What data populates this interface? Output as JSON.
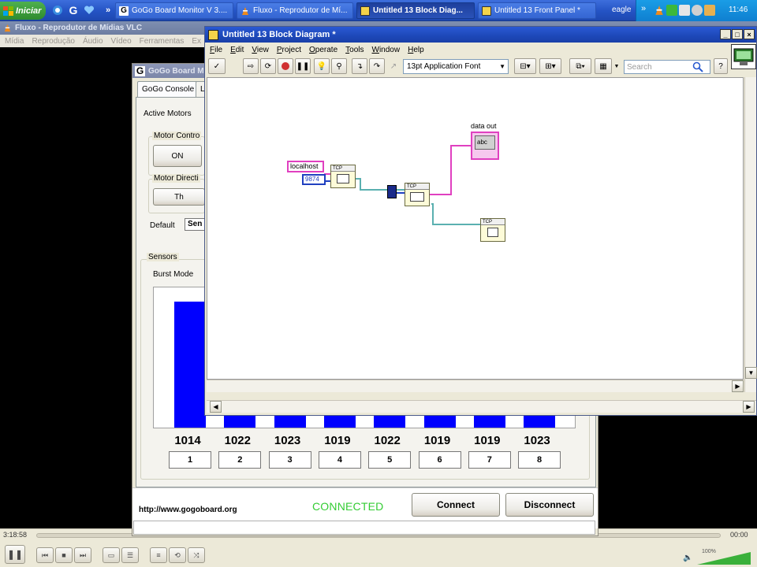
{
  "taskbar": {
    "start_label": "Iniciar",
    "tasks": [
      {
        "label": "GoGo Board Monitor V 3....",
        "active": false
      },
      {
        "label": "Fluxo - Reprodutor de Mí...",
        "active": false
      },
      {
        "label": "Untitled 13 Block Diag...",
        "active": true
      },
      {
        "label": "Untitled 13 Front Panel *",
        "active": false
      }
    ],
    "chevron": "»",
    "user": "eagle",
    "clock": "11:46"
  },
  "vlc": {
    "title": "Fluxo - Reprodutor de Mídias VLC",
    "menu": [
      "Mídia",
      "Reprodução",
      "Áudio",
      "Vídeo",
      "Ferramentas",
      "Ex"
    ],
    "time_elapsed": "3:18:58",
    "time_total": "00:00",
    "volume": "100%",
    "volume_level": 1.0
  },
  "gogo": {
    "title": "GoGo Board M",
    "tabs": [
      "GoGo Console",
      "L"
    ],
    "active_motors_label": "Active Motors",
    "motor_control_label": "Motor Contro",
    "on_label": "ON",
    "motor_direction_label": "Motor Directi",
    "th_label": "Th",
    "subtabs": [
      "Default",
      "Sen"
    ],
    "sensors_label": "Sensors",
    "burst_mode_label": "Burst Mode",
    "sensor_values": [
      "1014",
      "1022",
      "1023",
      "1019",
      "1022",
      "1019",
      "1019",
      "1023"
    ],
    "sensor_labels": [
      "1",
      "2",
      "3",
      "4",
      "5",
      "6",
      "7",
      "8"
    ],
    "url": "http://www.gogoboard.org",
    "status": "CONNECTED",
    "connect_label": "Connect",
    "disconnect_label": "Disconnect"
  },
  "labview": {
    "title": "Untitled 13 Block Diagram *",
    "menu": [
      "File",
      "Edit",
      "View",
      "Project",
      "Operate",
      "Tools",
      "Window",
      "Help"
    ],
    "font_select": "13pt Application Font",
    "search_placeholder": "Search",
    "nodes": {
      "host_constant": "localhost",
      "port_constant": "9874",
      "indicator_label": "data out",
      "indicator_value": "abc",
      "node_tag": "TCP"
    }
  },
  "colors": {
    "bar": "#0000ff",
    "connected": "#33cc33",
    "wire_string": "#e040c0",
    "wire_ref": "#5ab0b0",
    "xp_blue": "#2453c4"
  }
}
